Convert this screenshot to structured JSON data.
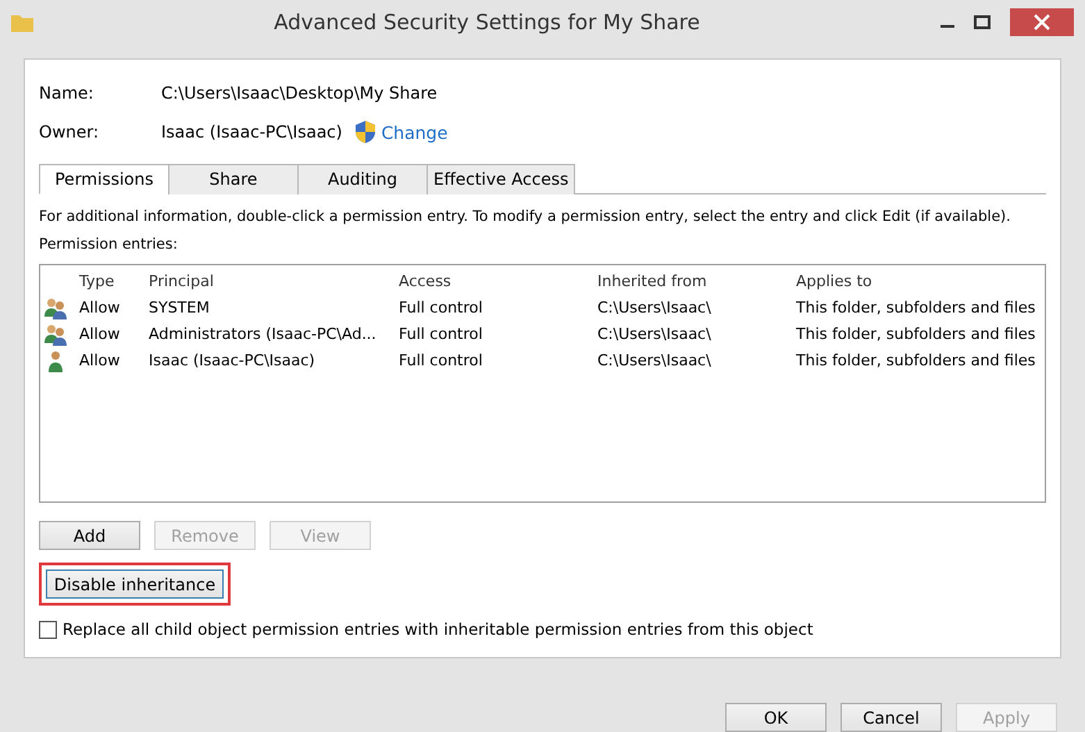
{
  "window": {
    "title": "Advanced Security Settings for My Share"
  },
  "name": {
    "label": "Name:",
    "value": "C:\\Users\\Isaac\\Desktop\\My Share"
  },
  "owner": {
    "label": "Owner:",
    "value": "Isaac (Isaac-PC\\Isaac)",
    "link": "Change"
  },
  "tabs": [
    {
      "label": "Permissions",
      "selected": true
    },
    {
      "label": "Share",
      "selected": false
    },
    {
      "label": "Auditing",
      "selected": false
    },
    {
      "label": "Effective Access",
      "selected": false
    }
  ],
  "info": "For additional information, double-click a permission entry. To modify a permission entry, select the entry and click Edit (if available).",
  "entries_label": "Permission entries:",
  "table": {
    "columns": [
      "Type",
      "Principal",
      "Access",
      "Inherited from",
      "Applies to"
    ],
    "rows": [
      {
        "kind": "group",
        "cells": [
          "Allow",
          "SYSTEM",
          "Full control",
          "C:\\Users\\Isaac\\",
          "This folder, subfolders and files"
        ]
      },
      {
        "kind": "group",
        "cells": [
          "Allow",
          "Administrators (Isaac-PC\\Ad...",
          "Full control",
          "C:\\Users\\Isaac\\",
          "This folder, subfolders and files"
        ]
      },
      {
        "kind": "user",
        "cells": [
          "Allow",
          "Isaac (Isaac-PC\\Isaac)",
          "Full control",
          "C:\\Users\\Isaac\\",
          "This folder, subfolders and files"
        ]
      }
    ]
  },
  "entry_buttons": [
    {
      "label": "Add",
      "disabled": false
    },
    {
      "label": "Remove",
      "disabled": true
    },
    {
      "label": "View",
      "disabled": true
    }
  ],
  "inheritance_button": {
    "label": "Disable inheritance",
    "highlighted": true
  },
  "replace_checkbox": {
    "label": "Replace all child object permission entries with inheritable permission entries from this object",
    "checked": false
  },
  "footer_buttons": [
    {
      "label": "OK",
      "disabled": false
    },
    {
      "label": "Cancel",
      "disabled": false
    },
    {
      "label": "Apply",
      "disabled": true
    }
  ]
}
